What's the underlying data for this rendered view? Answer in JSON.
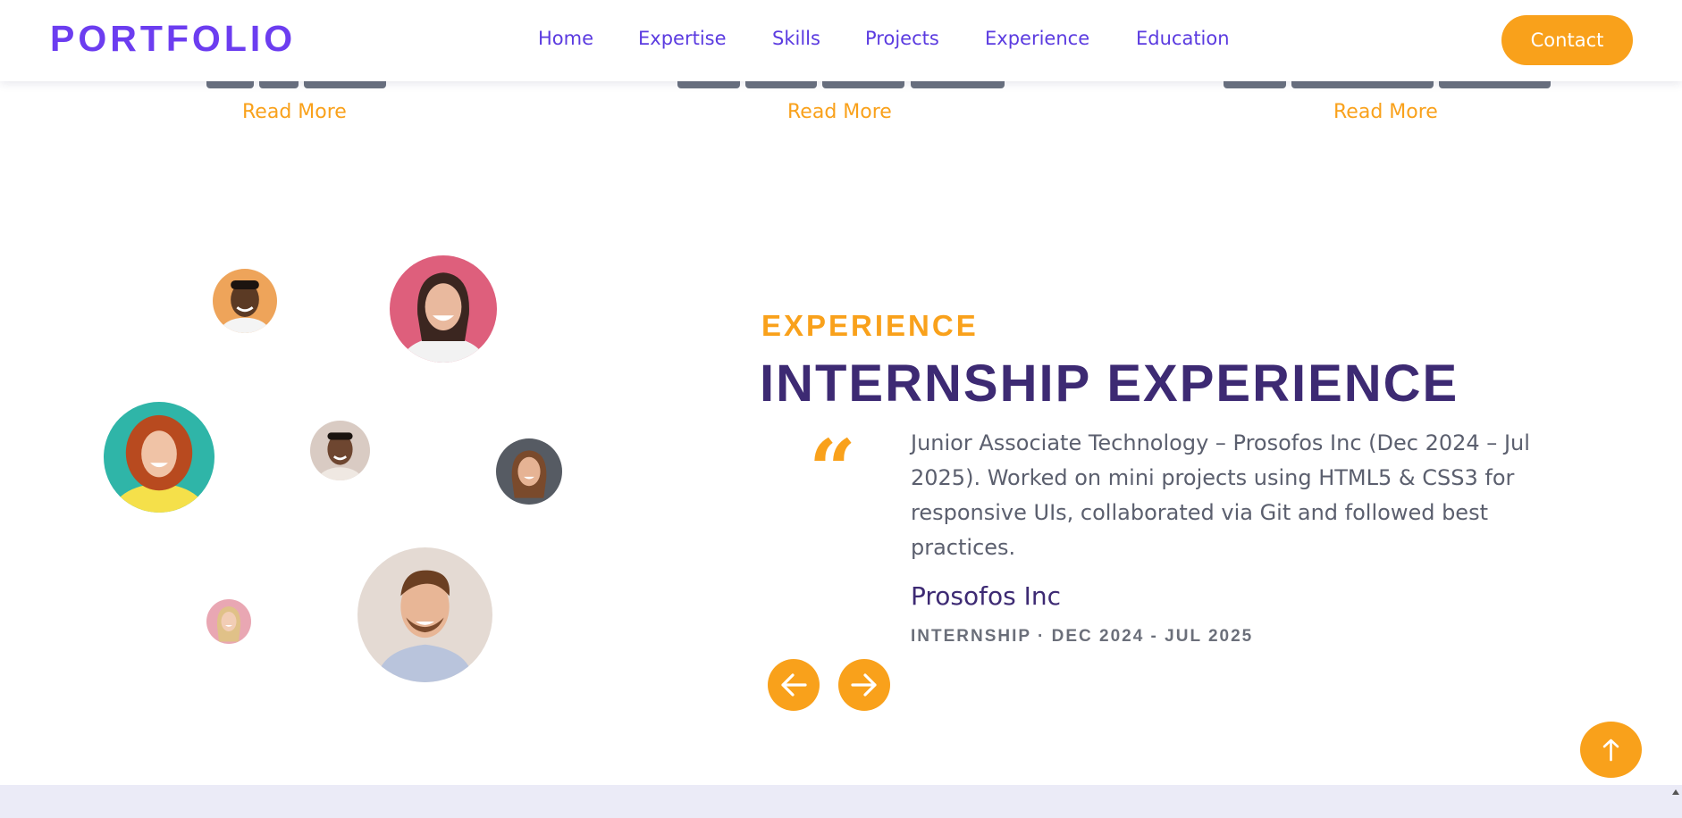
{
  "header": {
    "logo": "PORTFOLIO",
    "nav": [
      "Home",
      "Expertise",
      "Skills",
      "Projects",
      "Experience",
      "Education"
    ],
    "contact_label": "Contact"
  },
  "cards": {
    "read_more_label": "Read More"
  },
  "experience": {
    "eyebrow": "EXPERIENCE",
    "title": "INTERNSHIP EXPERIENCE",
    "quote_icon": "quote-icon",
    "description": "Junior Associate Technology – Prosofos Inc (Dec 2024 – Jul 2025). Worked on mini projects using HTML5 & CSS3 for responsive UIs, collaborated via Git and followed best practices.",
    "company": "Prosofos Inc",
    "meta": "INTERNSHIP · DEC 2024 - JUL 2025",
    "prev_icon": "arrow-left-icon",
    "next_icon": "arrow-right-icon"
  },
  "scroll_top_icon": "arrow-up-icon",
  "colors": {
    "accent": "#f9a11b",
    "brand": "#6c3df0",
    "nav": "#5b3be0",
    "title": "#3d2a73",
    "body_text": "#5b5f6e",
    "next_section_bg": "#ebebf7"
  }
}
